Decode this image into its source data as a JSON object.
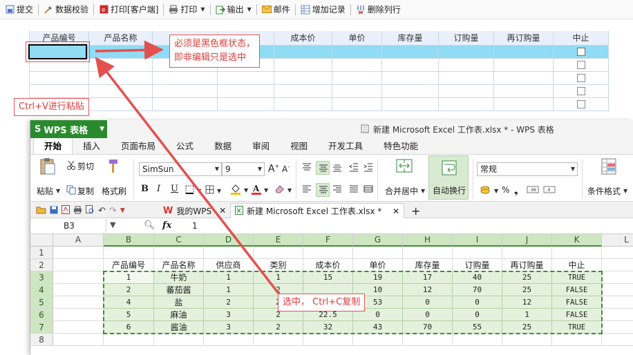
{
  "toolbar": {
    "items": [
      {
        "label": "提交",
        "icon": "submit-icon"
      },
      {
        "label": "数据校验",
        "icon": "validate-icon"
      },
      {
        "label": "打印[客户端]",
        "icon": "pdf-print-icon"
      },
      {
        "label": "打印",
        "icon": "printer-icon"
      },
      {
        "label": "输出",
        "icon": "export-icon"
      },
      {
        "label": "邮件",
        "icon": "mail-icon"
      },
      {
        "label": "增加记录",
        "icon": "add-record-icon"
      },
      {
        "label": "删除列行",
        "icon": "delete-rows-icon"
      }
    ]
  },
  "host_grid": {
    "columns": [
      "产品编号",
      "产品名称",
      "",
      "",
      "成本价",
      "单价",
      "库存量",
      "订购量",
      "再订购量",
      "中止"
    ],
    "row_count": 5,
    "selected_row": 1
  },
  "annotations": {
    "note_black_box": "必须是黑色框状态，\n即非编辑只是选中",
    "note_paste": "Ctrl+V进行粘贴",
    "note_copy": "选中，  Ctrl+C复制"
  },
  "wps": {
    "logo": "WPS 表格",
    "logo_mark": "S",
    "doc_title": "新建 Microsoft Excel 工作表.xlsx * - WPS 表格",
    "tabs": [
      "开始",
      "插入",
      "页面布局",
      "公式",
      "数据",
      "审阅",
      "视图",
      "开发工具",
      "特色功能"
    ],
    "active_tab": "开始",
    "ribbon": {
      "paste": "粘贴",
      "cut": "剪切",
      "copy": "复制",
      "format_painter": "格式刷",
      "font_name": "SimSun",
      "font_size": "9",
      "merge_center": "合并居中",
      "wrap_text": "自动换行",
      "number_format": "常规",
      "conditional_format": "条件格式",
      "bold": "B",
      "italic": "I",
      "underline": "U"
    },
    "doc_tabs": {
      "home": "我的WPS",
      "file": "新建 Microsoft Excel 工作表.xlsx *"
    },
    "formula_bar": {
      "cell_ref": "B3",
      "fx": "fx",
      "value": "1"
    },
    "sheet": {
      "col_letters": [
        "A",
        "B",
        "C",
        "D",
        "E",
        "F",
        "G",
        "H",
        "I",
        "J",
        "K",
        "L"
      ],
      "row_numbers": [
        "1",
        "2",
        "3",
        "4",
        "5",
        "6",
        "7",
        "8"
      ],
      "headers": [
        "产品编号",
        "产品名称",
        "供应商",
        "类别",
        "成本价",
        "单价",
        "库存量",
        "订购量",
        "再订购量",
        "中止"
      ],
      "rows": [
        [
          "1",
          "牛奶",
          "1",
          "1",
          "15",
          "19",
          "17",
          "40",
          "25",
          "TRUE"
        ],
        [
          "2",
          "蕃茄酱",
          "1",
          "2",
          "",
          "10",
          "12",
          "70",
          "25",
          "FALSE"
        ],
        [
          "4",
          "盐",
          "2",
          "2",
          "",
          "53",
          "0",
          "0",
          "12",
          "FALSE"
        ],
        [
          "5",
          "麻油",
          "3",
          "2",
          "22.5",
          "0",
          "0",
          "0",
          "1",
          "FALSE"
        ],
        [
          "6",
          "酱油",
          "3",
          "2",
          "32",
          "43",
          "70",
          "55",
          "25",
          "TRUE"
        ]
      ]
    }
  }
}
